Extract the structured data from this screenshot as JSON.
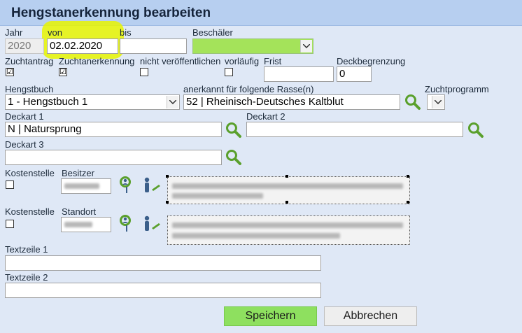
{
  "title": "Hengstanerkennung bearbeiten",
  "row1": {
    "jahr_label": "Jahr",
    "jahr_value": "2020",
    "von_label": "von",
    "von_value": "02.02.2020",
    "bis_label": "bis",
    "bis_value": "",
    "beschaeler_label": "Beschäler",
    "beschaeler_value": ""
  },
  "row2": {
    "zuchtantrag_label": "Zuchtantrag",
    "zuchtantrag_checked": "☑",
    "zuchtanerkennung_label": "Zuchtanerkennung",
    "zuchtanerkennung_checked": "☑",
    "nicht_veroeff_label": "nicht veröffentlichen",
    "vorlaeufig_label": "vorläufig",
    "frist_label": "Frist",
    "frist_value": "",
    "deckbegrenzung_label": "Deckbegrenzung",
    "deckbegrenzung_value": "0"
  },
  "row3": {
    "hengstbuch_label": "Hengstbuch",
    "hengstbuch_value": "1 - Hengstbuch 1",
    "rasse_label": "anerkannt für folgende Rasse(n)",
    "rasse_value": "52 | Rheinisch-Deutsches Kaltblut",
    "zuchtprogramm_label": "Zuchtprogramm",
    "zuchtprogramm_value": ""
  },
  "deckart": {
    "d1_label": "Deckart 1",
    "d1_value": "N | Natursprung",
    "d2_label": "Deckart 2",
    "d2_value": "",
    "d3_label": "Deckart 3",
    "d3_value": ""
  },
  "besitzer": {
    "kostenstelle_label": "Kostenstelle",
    "label": "Besitzer"
  },
  "standort": {
    "kostenstelle_label": "Kostenstelle",
    "label": "Standort"
  },
  "textzeile": {
    "t1_label": "Textzeile 1",
    "t1_value": "",
    "t2_label": "Textzeile 2",
    "t2_value": ""
  },
  "buttons": {
    "save": "Speichern",
    "cancel": "Abbrechen"
  },
  "colors": {
    "background": "#dfe8f6",
    "titlebar": "#b7cff0",
    "accent_green": "#8ee05f",
    "highlight": "#e8f500"
  },
  "icons": [
    "search-icon",
    "person-pin-icon",
    "person-edit-icon",
    "chevron-down-icon"
  ]
}
